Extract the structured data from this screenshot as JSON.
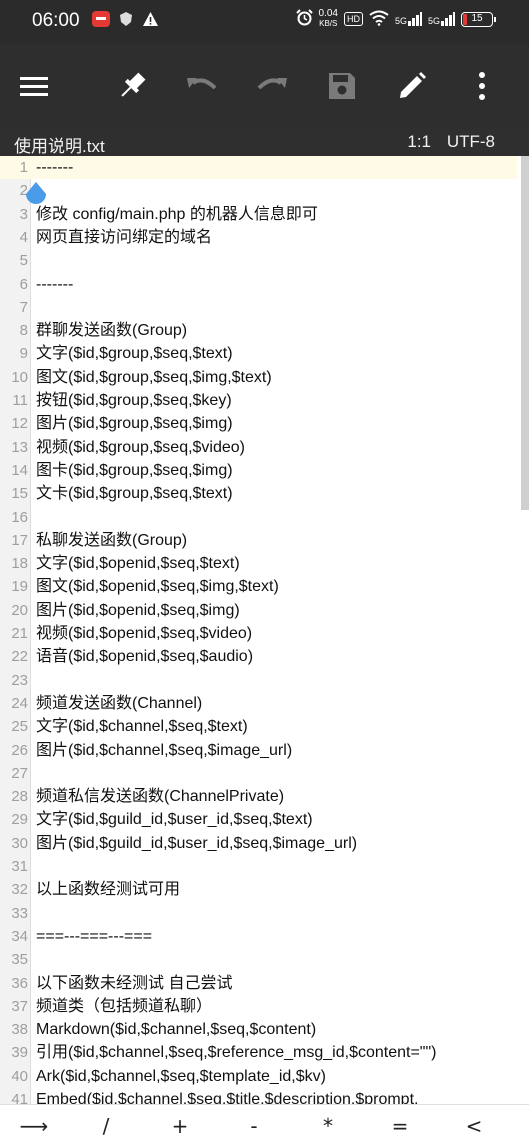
{
  "status_bar": {
    "time": "06:00",
    "net_speed_value": "0.04",
    "net_speed_unit": "KB/S",
    "hd_label": "HD",
    "signal_1": "5G",
    "signal_2": "5G",
    "battery": "15",
    "left_icons": [
      "app-notification-icon",
      "shield-icon",
      "warning-icon"
    ],
    "right_icons": [
      "alarm-icon",
      "wifi-icon"
    ]
  },
  "toolbar": {
    "icons": [
      "menu-icon",
      "pin-icon",
      "undo-icon",
      "redo-icon",
      "save-icon",
      "edit-icon",
      "more-vert-icon"
    ]
  },
  "file_bar": {
    "filename": "使用说明.txt",
    "cursor_position": "1:1",
    "encoding": "UTF-8"
  },
  "editor": {
    "lines": [
      {
        "n": "1",
        "text": "-------"
      },
      {
        "n": "2",
        "text": ""
      },
      {
        "n": "3",
        "text": "修改   config/main.php   的机器人信息即可"
      },
      {
        "n": "4",
        "text": "网页直接访问绑定的域名"
      },
      {
        "n": "5",
        "text": ""
      },
      {
        "n": "6",
        "text": "-------"
      },
      {
        "n": "7",
        "text": ""
      },
      {
        "n": "8",
        "text": "群聊发送函数(Group)"
      },
      {
        "n": "9",
        "text": "文字($id,$group,$seq,$text)"
      },
      {
        "n": "10",
        "text": "图文($id,$group,$seq,$img,$text)"
      },
      {
        "n": "11",
        "text": "按钮($id,$group,$seq,$key)"
      },
      {
        "n": "12",
        "text": "图片($id,$group,$seq,$img)"
      },
      {
        "n": "13",
        "text": "视频($id,$group,$seq,$video)"
      },
      {
        "n": "14",
        "text": "图卡($id,$group,$seq,$img)"
      },
      {
        "n": "15",
        "text": "文卡($id,$group,$seq,$text)"
      },
      {
        "n": "16",
        "text": ""
      },
      {
        "n": "17",
        "text": "私聊发送函数(Group)"
      },
      {
        "n": "18",
        "text": "文字($id,$openid,$seq,$text)"
      },
      {
        "n": "19",
        "text": "图文($id,$openid,$seq,$img,$text)"
      },
      {
        "n": "20",
        "text": "图片($id,$openid,$seq,$img)"
      },
      {
        "n": "21",
        "text": "视频($id,$openid,$seq,$video)"
      },
      {
        "n": "22",
        "text": "语音($id,$openid,$seq,$audio)"
      },
      {
        "n": "23",
        "text": ""
      },
      {
        "n": "24",
        "text": "频道发送函数(Channel)"
      },
      {
        "n": "25",
        "text": "文字($id,$channel,$seq,$text)"
      },
      {
        "n": "26",
        "text": "图片($id,$channel,$seq,$image_url)"
      },
      {
        "n": "27",
        "text": ""
      },
      {
        "n": "28",
        "text": "频道私信发送函数(ChannelPrivate)"
      },
      {
        "n": "29",
        "text": "文字($id,$guild_id,$user_id,$seq,$text)"
      },
      {
        "n": "30",
        "text": "图片($id,$guild_id,$user_id,$seq,$image_url)"
      },
      {
        "n": "31",
        "text": ""
      },
      {
        "n": "32",
        "text": "以上函数经测试可用"
      },
      {
        "n": "33",
        "text": ""
      },
      {
        "n": "34",
        "text": "===---===---==="
      },
      {
        "n": "35",
        "text": ""
      },
      {
        "n": "36",
        "text": "以下函数未经测试 自己尝试"
      },
      {
        "n": "37",
        "text": "频道类（包括频道私聊）"
      },
      {
        "n": "38",
        "text": "Markdown($id,$channel,$seq,$content)"
      },
      {
        "n": "39",
        "text": "引用($id,$channel,$seq,$reference_msg_id,$content=\"\")"
      },
      {
        "n": "40",
        "text": "Ark($id,$channel,$seq,$template_id,$kv)"
      },
      {
        "n": "41",
        "text": "Embed($id,$channel,$seq,$title,$description,$prompt,"
      }
    ]
  },
  "bottom_keys": [
    "⟶",
    "/",
    "+",
    "-",
    "*",
    "=",
    "<"
  ],
  "colors": {
    "status_bar_bg": "#2b2b2b",
    "toolbar_bg": "#2e2e2e",
    "current_line_bg": "#fffbe6",
    "gutter_bg": "#f2f2f2",
    "cursor_handle": "#4a9be8"
  }
}
